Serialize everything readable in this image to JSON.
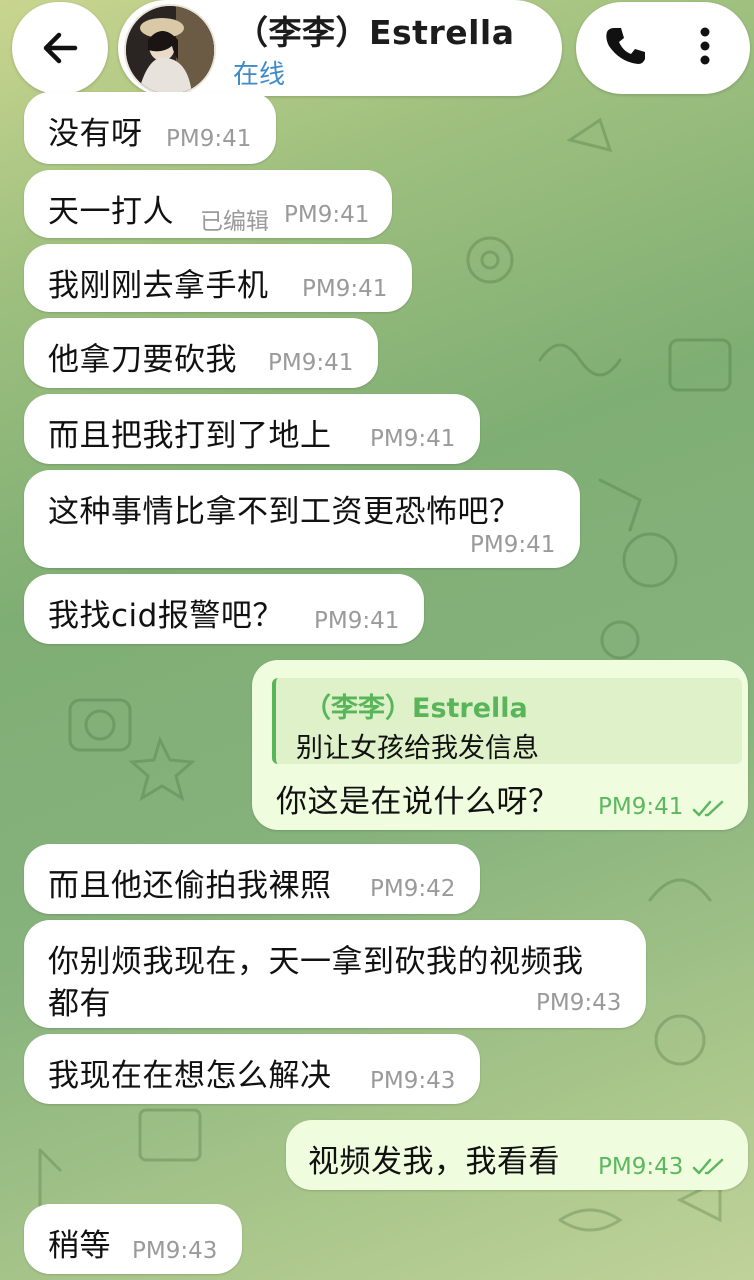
{
  "header": {
    "contact_name": "（李李）Estrella",
    "status": "在线"
  },
  "messages": [
    {
      "side": "in",
      "text": "没有呀",
      "time": "PM9:41"
    },
    {
      "side": "in",
      "text": "天一打人",
      "edited": "已编辑",
      "time": "PM9:41"
    },
    {
      "side": "in",
      "text": "我刚刚去拿手机",
      "time": "PM9:41"
    },
    {
      "side": "in",
      "text": "他拿刀要砍我",
      "time": "PM9:41"
    },
    {
      "side": "in",
      "text": "而且把我打到了地上",
      "time": "PM9:41"
    },
    {
      "side": "in",
      "text": "这种事情比拿不到工资更恐怖吧？",
      "time": "PM9:41"
    },
    {
      "side": "in",
      "text": "我找cid报警吧？",
      "time": "PM9:41"
    },
    {
      "side": "out",
      "reply_to": "（李李）Estrella",
      "reply_text": "别让女孩给我发信息",
      "text": "你这是在说什么呀？",
      "time": "PM9:41",
      "read": true
    },
    {
      "side": "in",
      "text": "而且他还偷拍我裸照",
      "time": "PM9:42"
    },
    {
      "side": "in",
      "text_line1": "你别烦我现在，天一拿到砍我的视频我",
      "text_line2": "都有",
      "time": "PM9:43"
    },
    {
      "side": "in",
      "text": "我现在在想怎么解决",
      "time": "PM9:43"
    },
    {
      "side": "out",
      "text": "视频发我，我看看",
      "time": "PM9:43",
      "read": true
    },
    {
      "side": "in",
      "text": "稍等",
      "time": "PM9:43"
    }
  ],
  "icons": {
    "back": "arrow-left-icon",
    "call": "phone-icon",
    "more": "more-vertical-icon",
    "read": "double-check-icon"
  },
  "colors": {
    "incoming_bubble": "#ffffff",
    "outgoing_bubble": "#effdde",
    "status_blue": "#3e8bc7",
    "accent_green": "#58b559"
  }
}
